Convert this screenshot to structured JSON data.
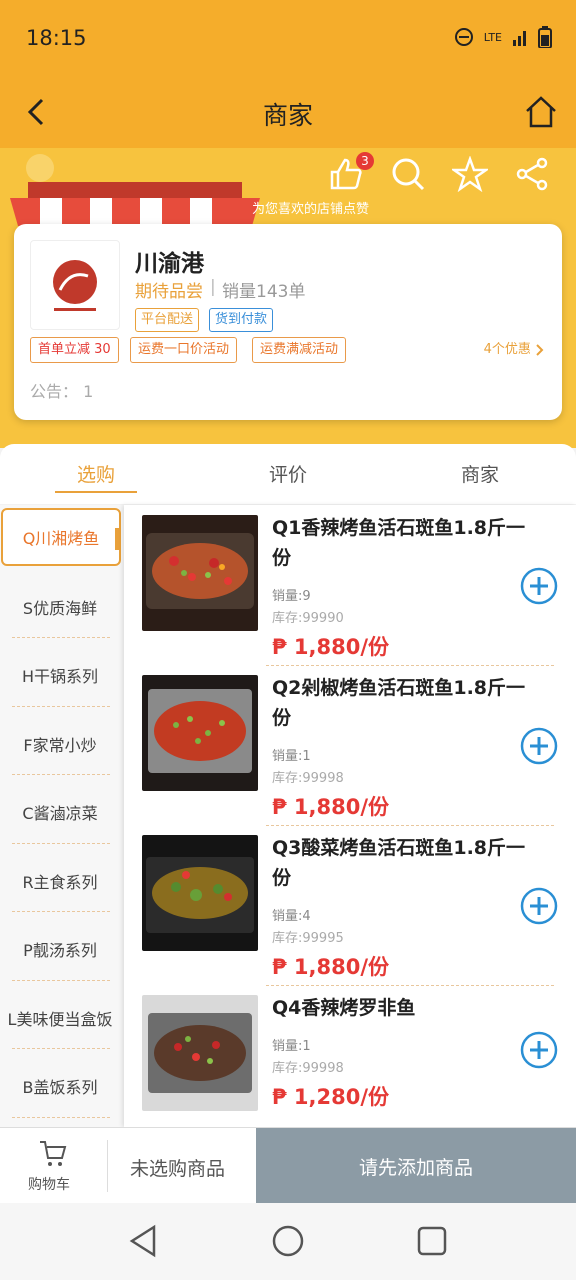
{
  "status": {
    "time": "18:15",
    "network": "LTE"
  },
  "nav": {
    "title": "商家"
  },
  "banner": {
    "tip": "为您喜欢的店铺点赞",
    "like_count": "3"
  },
  "shop": {
    "name": "川渝港",
    "slogan": "期待品尝",
    "sales": "销量143单",
    "tags": [
      "平台配送",
      "货到付款"
    ],
    "promos": [
      "首单立减 30",
      "运费一口价活动",
      "运费满减活动"
    ],
    "promo_count": "4个优惠",
    "notice": "公告： 1"
  },
  "tabs": [
    "选购",
    "评价",
    "商家"
  ],
  "categories": [
    "Q川湘烤鱼",
    "S优质海鲜",
    "H干锅系列",
    "F家常小炒",
    "C酱滷凉菜",
    "R主食系列",
    "P靓汤系列",
    "L美味便当盒饭",
    "B盖饭系列"
  ],
  "products": [
    {
      "name": "Q1香辣烤鱼活石斑鱼1.8斤一份",
      "sold": "销量:9",
      "stock": "库存:99990",
      "price": "₱ 1,880/份"
    },
    {
      "name": "Q2剁椒烤鱼活石斑鱼1.8斤一份",
      "sold": "销量:1",
      "stock": "库存:99998",
      "price": "₱ 1,880/份"
    },
    {
      "name": "Q3酸菜烤鱼活石斑鱼1.8斤一份",
      "sold": "销量:4",
      "stock": "库存:99995",
      "price": "₱ 1,880/份"
    },
    {
      "name": "Q4香辣烤罗非鱼",
      "sold": "销量:1",
      "stock": "库存:99998",
      "price": "₱ 1,280/份"
    }
  ],
  "cart": {
    "label": "购物车",
    "summary": "未选购商品",
    "submit": "请先添加商品"
  },
  "colors": {
    "brand": "#f5ad2b",
    "accent": "#e9a13a",
    "price": "#e53935",
    "add": "#2a8fd4"
  }
}
